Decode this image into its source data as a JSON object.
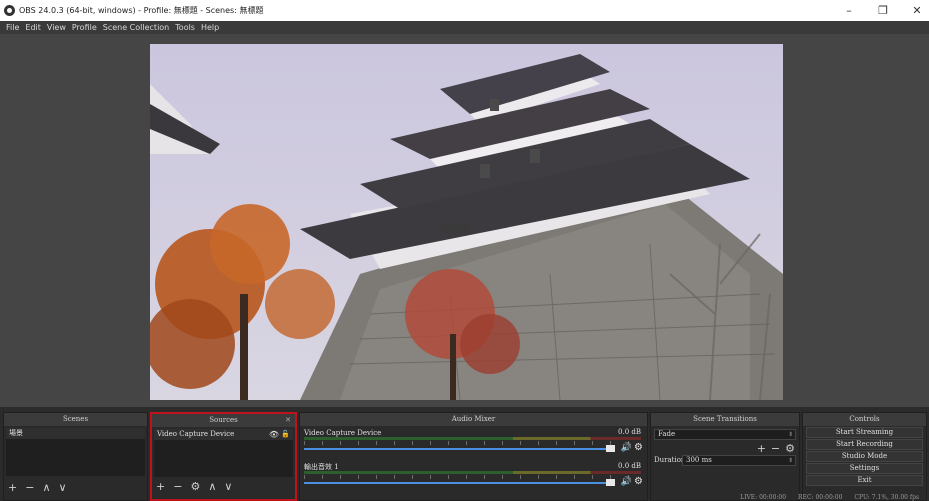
{
  "window": {
    "title": "OBS 24.0.3 (64-bit, windows) - Profile: 無標題 - Scenes: 無標題",
    "minimize": "–",
    "maximize": "❐",
    "close": "✕"
  },
  "menu": [
    "File",
    "Edit",
    "View",
    "Profile",
    "Scene Collection",
    "Tools",
    "Help"
  ],
  "preview": {
    "description_icon": "castle-photo"
  },
  "scenes": {
    "header": "Scenes",
    "items": [
      "場景"
    ],
    "toolbar": [
      "+",
      "−",
      "∧",
      "∨"
    ]
  },
  "sources": {
    "header": "Sources",
    "items": [
      "Video Capture Device"
    ],
    "toolbar": [
      "+",
      "−",
      "⚙",
      "∧",
      "∨"
    ]
  },
  "mixer": {
    "header": "Audio Mixer",
    "channels": [
      {
        "name": "Video Capture Device",
        "db": "0.0 dB"
      },
      {
        "name": "輸出音效 1",
        "db": "0.0 dB"
      }
    ]
  },
  "transitions": {
    "header": "Scene Transitions",
    "selected": "Fade",
    "duration_label": "Duration",
    "duration_value": "300 ms"
  },
  "controls": {
    "header": "Controls",
    "buttons": [
      "Start Streaming",
      "Start Recording",
      "Studio Mode",
      "Settings",
      "Exit"
    ]
  },
  "status": {
    "live": "LIVE: 00:00:00",
    "rec": "REC: 00:00:00",
    "cpu": "CPU: 7.1%, 30.00 fps"
  },
  "colors": {
    "accent_blue": "#4a8fe0",
    "highlight_red": "#c0121b"
  }
}
